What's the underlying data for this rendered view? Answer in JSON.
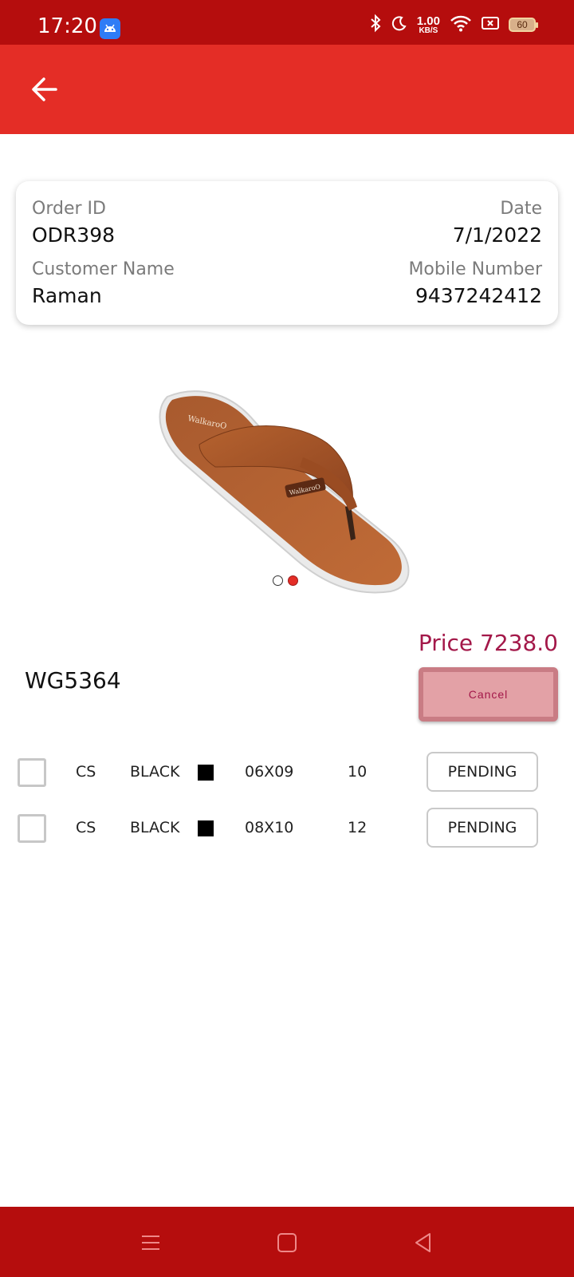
{
  "status_bar": {
    "time": "17:20",
    "net_speed_value": "1.00",
    "net_speed_unit": "KB/S",
    "battery": "60",
    "icons": [
      "android-app-icon",
      "bluetooth-icon",
      "moon-icon",
      "wifi-icon",
      "sim-off-icon",
      "battery-icon"
    ]
  },
  "app_bar": {
    "back_icon": "arrow-left-icon",
    "background": "#e42d26"
  },
  "order": {
    "order_id_label": "Order ID",
    "order_id": "ODR398",
    "date_label": "Date",
    "date": "7/1/2022",
    "customer_label": "Customer Name",
    "customer": "Raman",
    "mobile_label": "Mobile Number",
    "mobile": "9437242412"
  },
  "product": {
    "price": "Price 7238.0",
    "article": "WG5364",
    "cancel_label": "Cancel",
    "carousel_count": 2,
    "carousel_active": 1,
    "sizes": [
      {
        "type": "CS",
        "color": "BLACK",
        "swatch": "#000000",
        "size": "06X09",
        "qty": "10",
        "status": "PENDING"
      },
      {
        "type": "CS",
        "color": "BLACK",
        "swatch": "#000000",
        "size": "08X10",
        "qty": "12",
        "status": "PENDING"
      }
    ]
  },
  "colors": {
    "status_bar": "#b50d0d",
    "app_bar": "#e42d26",
    "accent": "#a31849"
  }
}
